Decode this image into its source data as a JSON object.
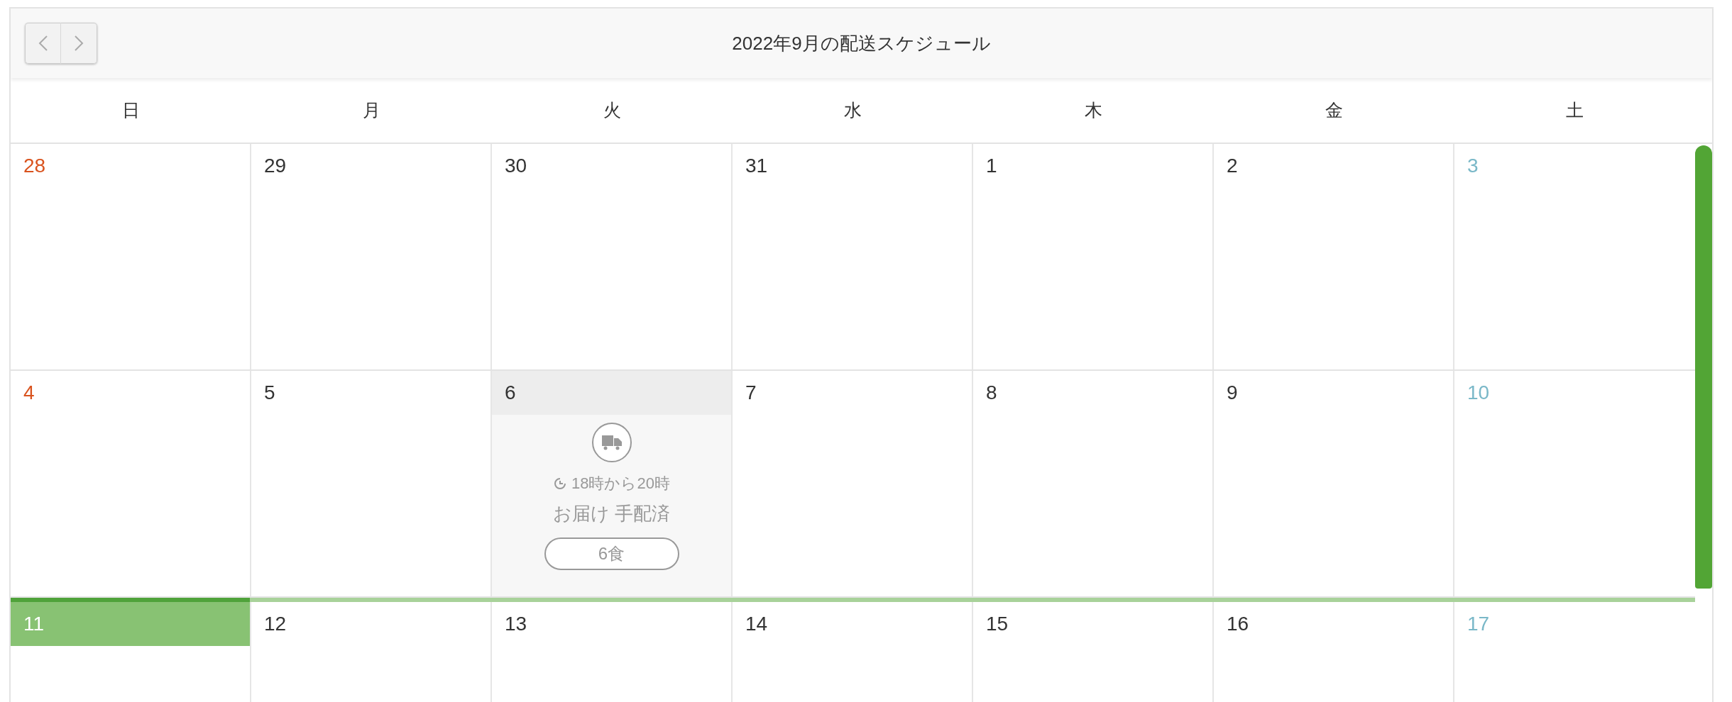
{
  "header": {
    "title": "2022年9月の配送スケジュール"
  },
  "weekdays": [
    {
      "label": "日"
    },
    {
      "label": "月"
    },
    {
      "label": "火"
    },
    {
      "label": "水"
    },
    {
      "label": "木"
    },
    {
      "label": "金"
    },
    {
      "label": "土"
    }
  ],
  "weeks": [
    {
      "current": false,
      "days": [
        {
          "date": "28",
          "kind": "sunday",
          "today": false
        },
        {
          "date": "29",
          "kind": "weekday",
          "today": false
        },
        {
          "date": "30",
          "kind": "weekday",
          "today": false
        },
        {
          "date": "31",
          "kind": "weekday",
          "today": false
        },
        {
          "date": "1",
          "kind": "weekday",
          "today": false
        },
        {
          "date": "2",
          "kind": "weekday",
          "today": false
        },
        {
          "date": "3",
          "kind": "saturday",
          "today": false
        }
      ]
    },
    {
      "current": false,
      "days": [
        {
          "date": "4",
          "kind": "sunday",
          "today": false
        },
        {
          "date": "5",
          "kind": "weekday",
          "today": false
        },
        {
          "date": "6",
          "kind": "weekday",
          "today": false,
          "delivery": {
            "time": "18時から20時",
            "status": "お届け 手配済",
            "meals": "6食"
          }
        },
        {
          "date": "7",
          "kind": "weekday",
          "today": false
        },
        {
          "date": "8",
          "kind": "weekday",
          "today": false
        },
        {
          "date": "9",
          "kind": "weekday",
          "today": false
        },
        {
          "date": "10",
          "kind": "saturday",
          "today": false
        }
      ]
    },
    {
      "current": true,
      "days": [
        {
          "date": "11",
          "today": true
        },
        {
          "date": "12",
          "kind": "weekday",
          "today": false
        },
        {
          "date": "13",
          "kind": "weekday",
          "today": false
        },
        {
          "date": "14",
          "kind": "weekday",
          "today": false
        },
        {
          "date": "15",
          "kind": "weekday",
          "today": false
        },
        {
          "date": "16",
          "kind": "weekday",
          "today": false
        },
        {
          "date": "17",
          "kind": "saturday",
          "today": false
        }
      ]
    }
  ]
}
